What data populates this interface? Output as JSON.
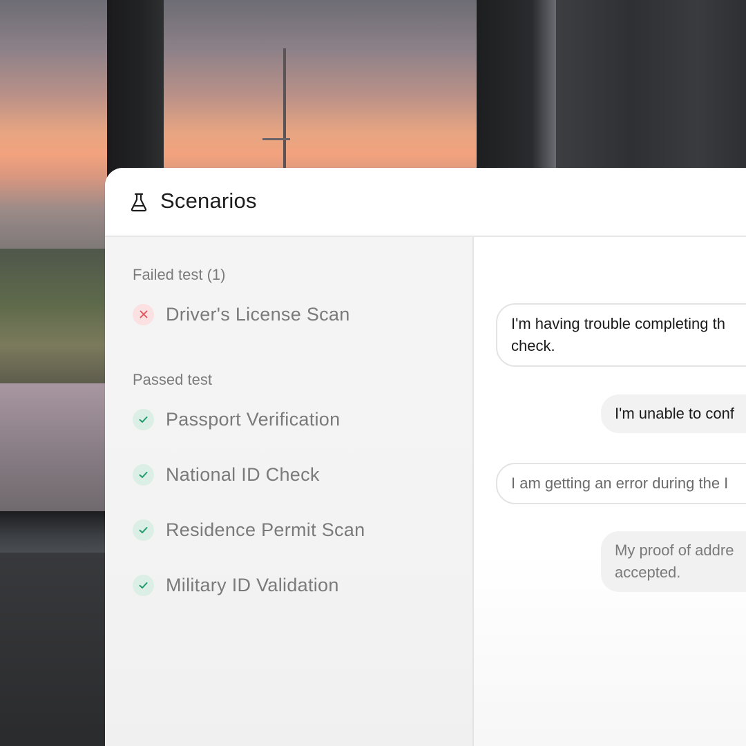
{
  "window": {
    "title": "Scenarios",
    "icon": "flask-icon"
  },
  "sidebar": {
    "failed_heading": "Failed test (1)",
    "failed": [
      {
        "label": "Driver's License Scan",
        "status": "failed",
        "icon": "x-icon"
      }
    ],
    "passed_heading": "Passed test",
    "passed": [
      {
        "label": "Passport Verification",
        "status": "passed",
        "icon": "check-icon"
      },
      {
        "label": "National ID Check",
        "status": "passed",
        "icon": "check-icon"
      },
      {
        "label": "Residence Permit Scan",
        "status": "passed",
        "icon": "check-icon"
      },
      {
        "label": "Military ID Validation",
        "status": "passed",
        "icon": "check-icon"
      }
    ]
  },
  "chat": {
    "messages": [
      {
        "line1": "I'm having trouble completing th",
        "line2": "check."
      },
      {
        "line1": "I'm unable to conf"
      },
      {
        "line1": "I am getting an error during the I"
      },
      {
        "line1": "My proof of addre",
        "line2": "accepted."
      }
    ]
  },
  "colors": {
    "fail_bg": "#fbe1e2",
    "fail_icon": "#e0525a",
    "pass_bg": "#dcefe6",
    "pass_icon": "#1f9b6b",
    "text_primary": "#1b1b1b",
    "text_muted": "#7a7a7a"
  }
}
